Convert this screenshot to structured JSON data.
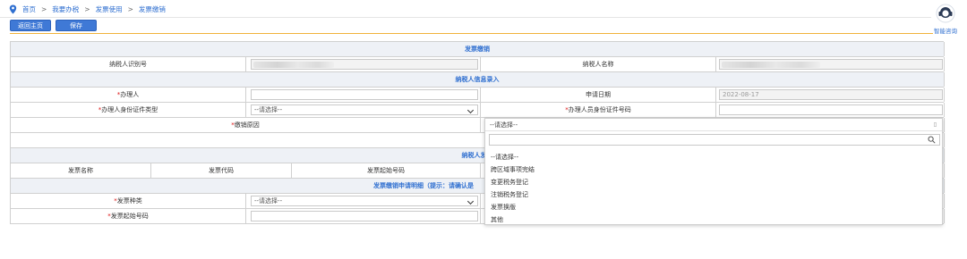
{
  "breadcrumb": {
    "home": "首页",
    "level1": "我要办税",
    "level2": "发票使用",
    "level3": "发票缴销",
    "sep": ">"
  },
  "toolbar": {
    "back_label": "返回主页",
    "save_label": "保存"
  },
  "assistant": {
    "label": "智能咨询"
  },
  "form": {
    "title": "发票缴销",
    "taxpayer_id_label": "纳税人识别号",
    "taxpayer_name_label": "纳税人名称",
    "section_info": "纳税人信息录入",
    "handler_label": "办理人",
    "apply_date_label": "申请日期",
    "apply_date_value": "2022-08-17",
    "id_type_label": "办理人身份证件类型",
    "id_type_value": "--请选择--",
    "id_number_label": "办理人员身份证件号码",
    "reason_label": "缴销原因",
    "section_invoice": "纳税人发票",
    "col_invoice_name": "发票名称",
    "col_invoice_code": "发票代码",
    "col_invoice_start": "发票起始号码",
    "section_detail": "发票缴销申请明细（提示：请确认是",
    "invoice_kind_label": "发票种类",
    "invoice_kind_value": "--请选择--",
    "invoice_start_label": "发票起始号码",
    "required_mark": "*"
  },
  "dropdown": {
    "selected": "--请选择--",
    "options": [
      "--请选择--",
      "跨区域事项完结",
      "变更税务登记",
      "注销税务登记",
      "发票换版",
      "其他"
    ]
  },
  "colors": {
    "accent": "#3f79d6",
    "link": "#2f6fd0",
    "gold": "#f0b23a",
    "section_bg": "#eef1f6"
  }
}
